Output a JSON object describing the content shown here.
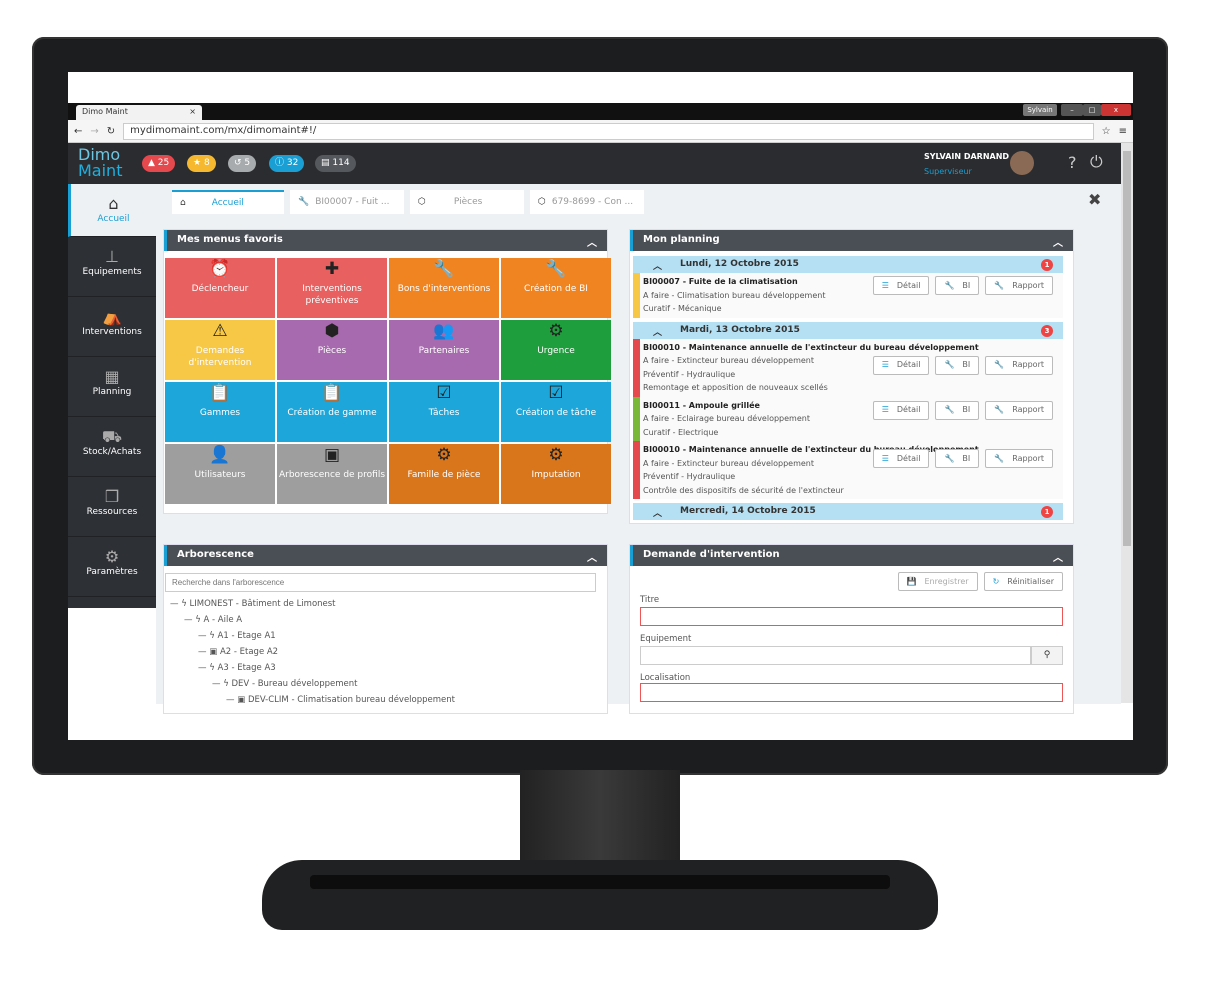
{
  "browser": {
    "tab_title": "Dimo Maint",
    "url": "mydimomaint.com/mx/dimomaint#!/",
    "profile": "Sylvain"
  },
  "header": {
    "logo_line1": "Dimo",
    "logo_line2": "Maint",
    "badges": [
      {
        "icon": "bell-icon",
        "count": "25",
        "color": "#e5484d"
      },
      {
        "icon": "star-icon",
        "count": "8",
        "color": "#f5b82e"
      },
      {
        "icon": "history-icon",
        "count": "5",
        "color": "#a8abae"
      },
      {
        "icon": "info-icon",
        "count": "32",
        "color": "#1a9fd4"
      },
      {
        "icon": "document-icon",
        "count": "114",
        "color": "#55585c"
      }
    ],
    "user_name": "SYLVAIN DARNAND",
    "user_role": "Superviseur"
  },
  "sidebar": {
    "items": [
      {
        "label": "Accueil",
        "icon": "home-icon"
      },
      {
        "label": "Equipements",
        "icon": "sitemap-icon"
      },
      {
        "label": "Interventions",
        "icon": "basket-icon"
      },
      {
        "label": "Planning",
        "icon": "calendar-icon"
      },
      {
        "label": "Stock/Achats",
        "icon": "cart-icon"
      },
      {
        "label": "Ressources",
        "icon": "cubes-icon"
      },
      {
        "label": "Paramètres",
        "icon": "gears-icon"
      }
    ]
  },
  "tabs": [
    {
      "label": "Accueil"
    },
    {
      "label": "BI00007 - Fuit ..."
    },
    {
      "label": "Pièces"
    },
    {
      "label": "679-8699 - Con ..."
    }
  ],
  "favoris": {
    "title": "Mes menus favoris",
    "tiles": [
      {
        "label": "Déclencheur",
        "icon": "⏰",
        "color": "#e8605f"
      },
      {
        "label": "Interventions préventives",
        "icon": "✚",
        "color": "#e8605f"
      },
      {
        "label": "Bons d'interventions",
        "icon": "🔧",
        "color": "#ef8421"
      },
      {
        "label": "Création de BI",
        "icon": "🔧",
        "color": "#ef8421"
      },
      {
        "label": "Demandes d'intervention",
        "icon": "⚠",
        "color": "#f7c746"
      },
      {
        "label": "Pièces",
        "icon": "⬢",
        "color": "#a86aae"
      },
      {
        "label": "Partenaires",
        "icon": "👥",
        "color": "#a86aae"
      },
      {
        "label": "Urgence",
        "icon": "⚙",
        "color": "#1f9e3d"
      },
      {
        "label": "Gammes",
        "icon": "📋",
        "color": "#1ca6da"
      },
      {
        "label": "Création de gamme",
        "icon": "📋",
        "color": "#1ca6da"
      },
      {
        "label": "Tâches",
        "icon": "☑",
        "color": "#1ca6da"
      },
      {
        "label": "Création de tâche",
        "icon": "☑",
        "color": "#1ca6da"
      },
      {
        "label": "Utilisateurs",
        "icon": "👤",
        "color": "#9e9e9e"
      },
      {
        "label": "Arborescence de profils",
        "icon": "▣",
        "color": "#9e9e9e"
      },
      {
        "label": "Famille de pièce",
        "icon": "⚙",
        "color": "#d9761c"
      },
      {
        "label": "Imputation",
        "icon": "⚙",
        "color": "#d9761c"
      }
    ]
  },
  "planning": {
    "title": "Mon planning",
    "btn_detail": "Détail",
    "btn_bi": "BI",
    "btn_rapport": "Rapport",
    "days": [
      {
        "date": "Lundi, 12 Octobre 2015",
        "count": "1"
      },
      {
        "date": "Mardi, 13 Octobre 2015",
        "count": "3"
      },
      {
        "date": "Mercredi, 14 Octobre 2015",
        "count": "1"
      }
    ],
    "events": [
      {
        "title": "BI00007 - Fuite de la climatisation",
        "l1": "A faire - Climatisation bureau développement",
        "l2": "Curatif - Mécanique",
        "l3": "",
        "color": "#f7c746"
      },
      {
        "title": "BI00010 - Maintenance annuelle de l'extincteur du bureau développement",
        "l1": "A faire - Extincteur bureau développement",
        "l2": "Préventif - Hydraulique",
        "l3": "Remontage et apposition de nouveaux scellés",
        "color": "#e5484d"
      },
      {
        "title": "BI00011 - Ampoule grillée",
        "l1": "A faire - Eclairage bureau développement",
        "l2": "Curatif - Electrique",
        "l3": "",
        "color": "#7ab83a"
      },
      {
        "title": "BI00010 - Maintenance annuelle de l'extincteur du bureau développement",
        "l1": "A faire - Extincteur bureau développement",
        "l2": "Préventif - Hydraulique",
        "l3": "Contrôle des dispositifs de sécurité de l'extincteur",
        "color": "#e5484d"
      }
    ]
  },
  "arbo": {
    "title": "Arborescence",
    "search_placeholder": "Recherche dans l'arborescence",
    "nodes": [
      "LIMONEST - Bâtiment de Limonest",
      "A - Aile A",
      "A1 - Etage A1",
      "A2 - Etage A2",
      "A3 - Etage A3",
      "DEV - Bureau développement",
      "DEV-CLIM - Climatisation bureau développement"
    ]
  },
  "demande": {
    "title": "Demande d'intervention",
    "save": "Enregistrer",
    "reset": "Réinitialiser",
    "titre_label": "Titre",
    "titre_value": "",
    "equip_label": "Equipement",
    "equip_value": "",
    "loc_label": "Localisation"
  }
}
